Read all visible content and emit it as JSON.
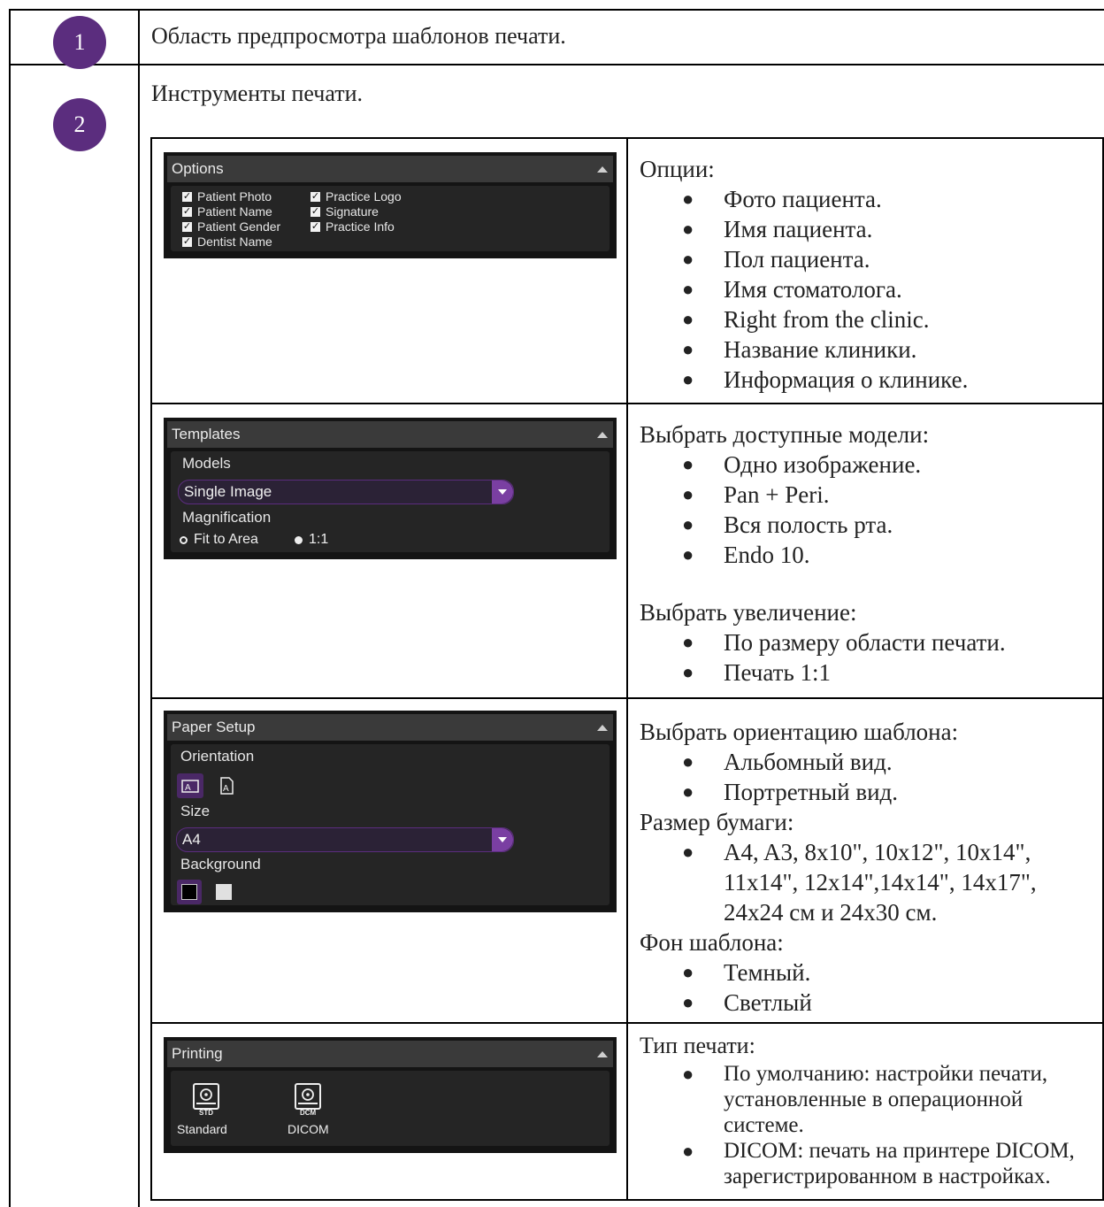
{
  "rows": [
    {
      "number": "1",
      "text": "Область предпросмотра шаблонов печати."
    },
    {
      "number": "2",
      "text": "Инструменты печати."
    }
  ],
  "options_panel": {
    "title": "Options",
    "checkboxes": [
      "Patient Photo",
      "Practice Logo",
      "Patient Name",
      "Signature",
      "Patient Gender",
      "Practice Info",
      "Dentist Name"
    ]
  },
  "options_desc": {
    "heading": "Опции:",
    "items": [
      "Фото пациента.",
      "Имя пациента.",
      "Пол пациента.",
      "Имя стоматолога.",
      "Right from the clinic.",
      "Название клиники.",
      "Информация о клинике."
    ]
  },
  "templates_panel": {
    "title": "Templates",
    "models_label": "Models",
    "model_value": "Single Image",
    "magnification_label": "Magnification",
    "radio_fit": "Fit to Area",
    "radio_one": "1:1"
  },
  "templates_desc": {
    "heading1": "Выбрать доступные модели:",
    "items1": [
      "Одно изображение.",
      "Pan + Peri.",
      "Вся полость рта.",
      "Endo 10."
    ],
    "heading2": "Выбрать увеличение:",
    "items2": [
      "По размеру области печати.",
      "Печать 1:1"
    ]
  },
  "paper_panel": {
    "title": "Paper Setup",
    "orientation_label": "Orientation",
    "size_label": "Size",
    "size_value": "A4",
    "background_label": "Background"
  },
  "paper_desc": {
    "heading1": "Выбрать ориентацию шаблона:",
    "items1": [
      "Альбомный вид.",
      "Портретный вид."
    ],
    "heading2": "Размер бумаги:",
    "sizes_line1": "A4, A3, 8x10\", 10x12\", 10x14\",",
    "sizes_line2": "11x14\", 12x14\",14x14\", 14x17\",",
    "sizes_line3": "24x24 см и 24x30 см.",
    "heading3": "Фон шаблона:",
    "items3": [
      "Темный.",
      "Светлый"
    ]
  },
  "printing_panel": {
    "title": "Printing",
    "standard_tag": "STD",
    "standard_label": "Standard",
    "dicom_tag": "DCM",
    "dicom_label": "DICOM"
  },
  "printing_desc": {
    "heading": "Тип печати:",
    "item1_line1": "По умолчанию: настройки печати,",
    "item1_line2": "установленные в операционной",
    "item1_line3": "системе.",
    "item2_line1": "DICOM: печать на принтере DICOM,",
    "item2_line2": "зарегистрированном в настройках."
  },
  "colors": {
    "badge": "#5b2d7e",
    "accent": "#7a3fa2",
    "panel_bg": "#252525",
    "panel_header": "#3a3a3a"
  }
}
